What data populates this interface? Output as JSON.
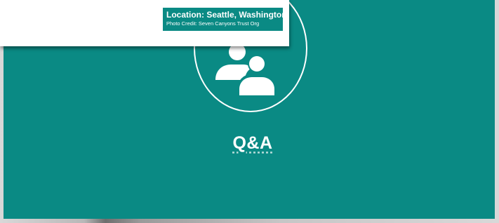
{
  "slide": {
    "title": "Q&A",
    "icon": "people-discussion-icon",
    "background_color": "#0a8a84"
  },
  "photo_card": {
    "location": "Location: Seattle, Washington",
    "credit": "Photo Credit: Seven Canyons Trust Org"
  }
}
